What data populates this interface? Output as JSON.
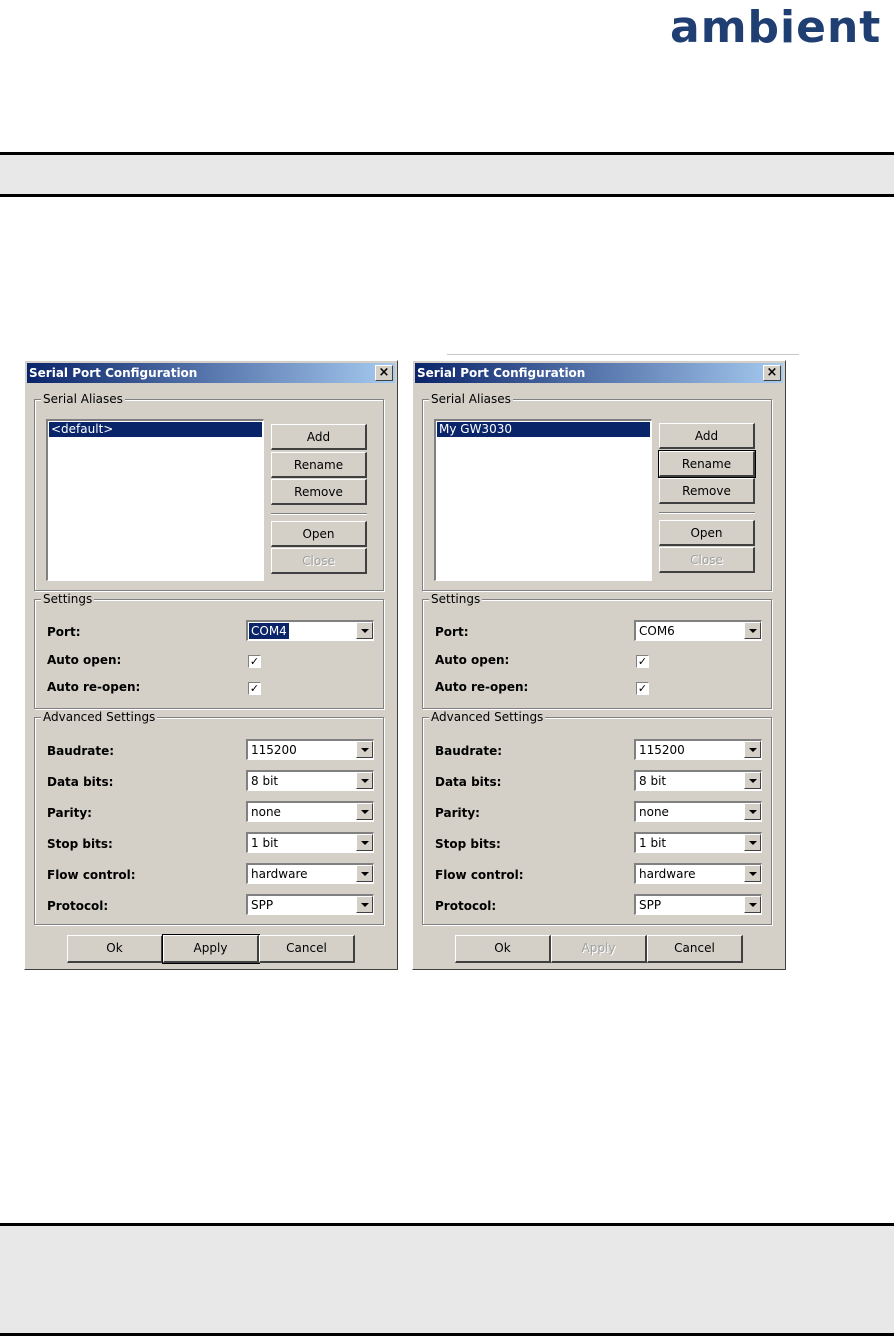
{
  "logo": {
    "text": "ambient",
    "color": "#1f3e72"
  },
  "dialogs": [
    {
      "title": "Serial Port Configuration",
      "close_glyph": "×",
      "serial_aliases": {
        "label": "Serial Aliases",
        "items": [
          "<default>"
        ],
        "buttons": {
          "add": "Add",
          "rename": "Rename",
          "remove": "Remove",
          "open": "Open",
          "close": "Close"
        }
      },
      "settings": {
        "label": "Settings",
        "port_label": "Port:",
        "port_value": "COM4",
        "auto_open_label": "Auto open:",
        "auto_open_checked": true,
        "auto_reopen_label": "Auto re-open:",
        "auto_reopen_checked": true
      },
      "advanced": {
        "label": "Advanced Settings",
        "rows": [
          {
            "label": "Baudrate:",
            "value": "115200"
          },
          {
            "label": "Data bits:",
            "value": "8 bit"
          },
          {
            "label": "Parity:",
            "value": "none"
          },
          {
            "label": "Stop bits:",
            "value": "1 bit"
          },
          {
            "label": "Flow control:",
            "value": "hardware"
          },
          {
            "label": "Protocol:",
            "value": "SPP"
          }
        ]
      },
      "footer": {
        "ok": "Ok",
        "apply": "Apply",
        "cancel": "Cancel"
      }
    },
    {
      "title": "Serial Port Configuration",
      "close_glyph": "×",
      "serial_aliases": {
        "label": "Serial Aliases",
        "items": [
          "My GW3030"
        ],
        "buttons": {
          "add": "Add",
          "rename": "Rename",
          "remove": "Remove",
          "open": "Open",
          "close": "Close"
        }
      },
      "settings": {
        "label": "Settings",
        "port_label": "Port:",
        "port_value": "COM6",
        "auto_open_label": "Auto open:",
        "auto_open_checked": true,
        "auto_reopen_label": "Auto re-open:",
        "auto_reopen_checked": true
      },
      "advanced": {
        "label": "Advanced Settings",
        "rows": [
          {
            "label": "Baudrate:",
            "value": "115200"
          },
          {
            "label": "Data bits:",
            "value": "8 bit"
          },
          {
            "label": "Parity:",
            "value": "none"
          },
          {
            "label": "Stop bits:",
            "value": "1 bit"
          },
          {
            "label": "Flow control:",
            "value": "hardware"
          },
          {
            "label": "Protocol:",
            "value": "SPP"
          }
        ]
      },
      "footer": {
        "ok": "Ok",
        "apply": "Apply",
        "cancel": "Cancel"
      }
    }
  ]
}
